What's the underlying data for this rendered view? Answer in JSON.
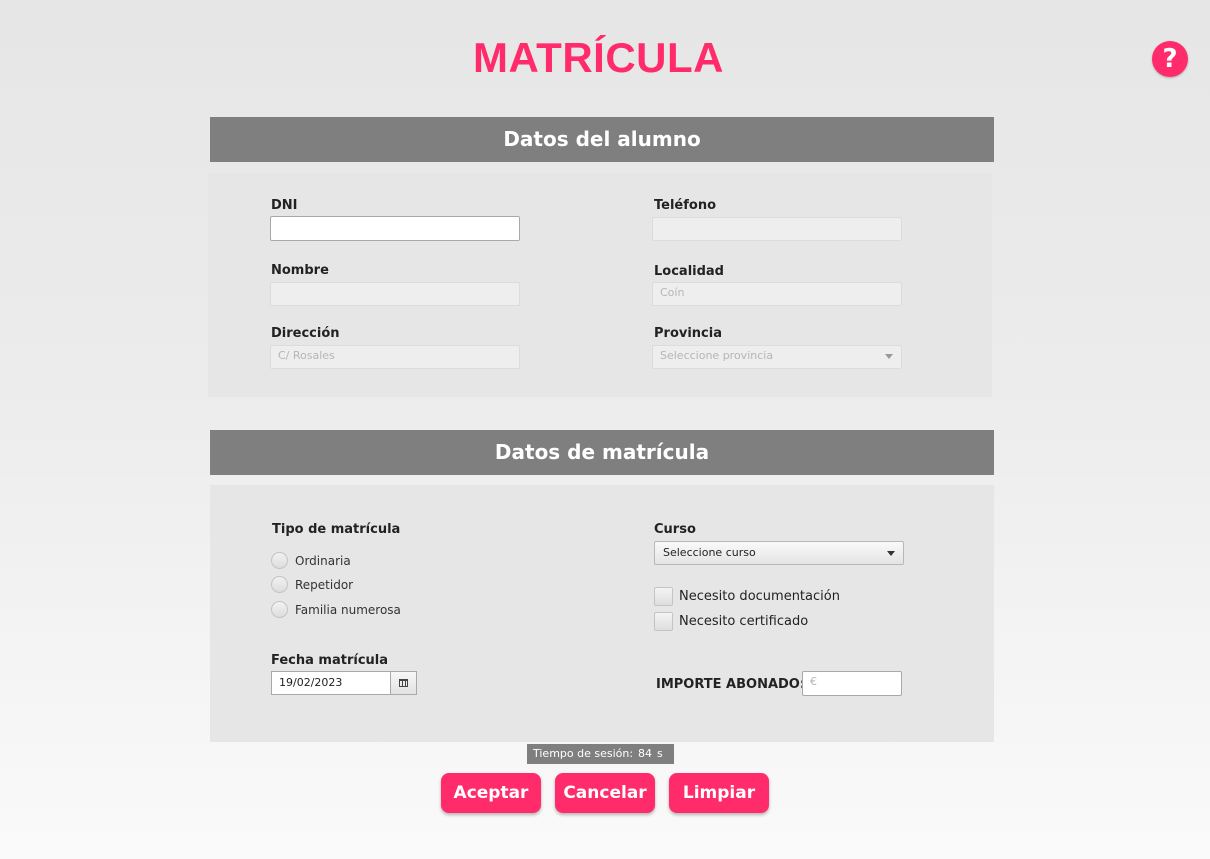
{
  "header": {
    "title": "MATRÍCULA",
    "help_icon": "?"
  },
  "student_section": {
    "heading": "Datos del alumno",
    "dni": {
      "label": "DNI",
      "value": "",
      "placeholder": ""
    },
    "telefono": {
      "label": "Teléfono",
      "value": "",
      "placeholder": ""
    },
    "nombre": {
      "label": "Nombre",
      "value": "",
      "placeholder": ""
    },
    "localidad": {
      "label": "Localidad",
      "value": "",
      "placeholder": "Coín"
    },
    "direccion": {
      "label": "Dirección",
      "value": "",
      "placeholder": "C/ Rosales"
    },
    "provincia": {
      "label": "Provincia",
      "selected": "Seleccione provincia"
    }
  },
  "enrollment_section": {
    "heading": "Datos de matrícula",
    "tipo": {
      "label": "Tipo de matrícula",
      "options": [
        "Ordinaria",
        "Repetidor",
        "Familia numerosa"
      ]
    },
    "curso": {
      "label": "Curso",
      "selected": "Seleccione curso"
    },
    "checkboxes": [
      "Necesito documentación",
      "Necesito certificado"
    ],
    "fecha": {
      "label": "Fecha matrícula",
      "value": "19/02/2023"
    },
    "importe": {
      "label": "IMPORTE ABONADO:",
      "placeholder": "€"
    }
  },
  "session": {
    "label": "Tiempo de sesión:",
    "value": "84",
    "unit": "s"
  },
  "buttons": {
    "accept": "Aceptar",
    "cancel": "Cancelar",
    "clear": "Limpiar"
  },
  "colors": {
    "accent": "#ff2b6a",
    "section_header": "#7f7f7f",
    "panel": "#e6e6e6"
  }
}
